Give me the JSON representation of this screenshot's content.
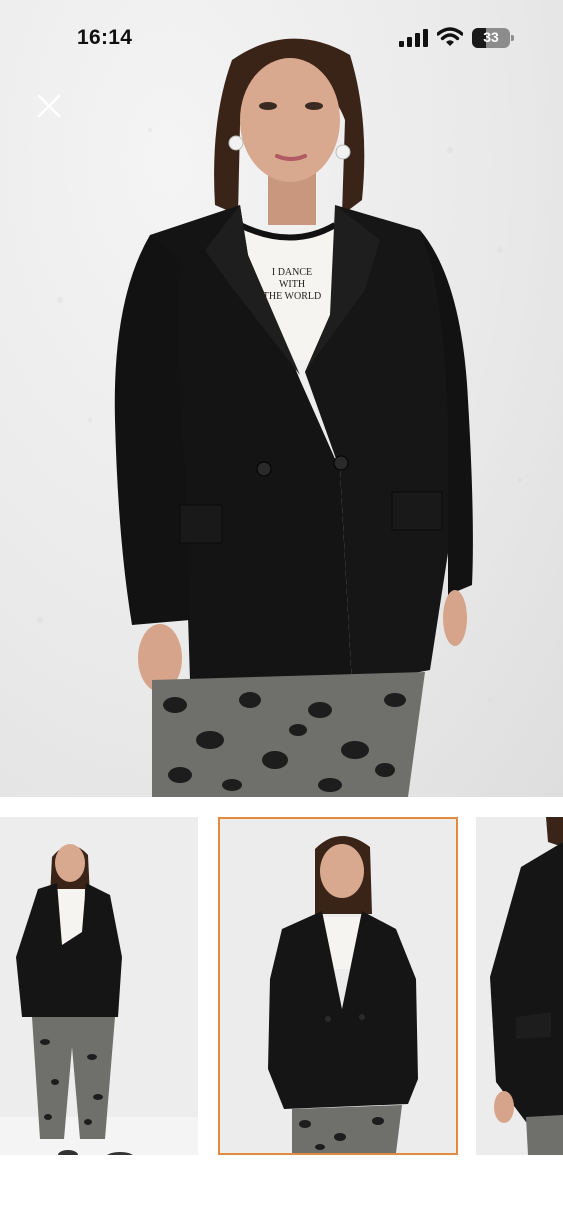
{
  "status_bar": {
    "time": "16:14",
    "battery_level": "33",
    "icons": [
      "cellular-signal-icon",
      "wifi-icon",
      "battery-icon"
    ]
  },
  "hero": {
    "image": "model-in-black-double-breasted-blazer",
    "shirt_text_line1": "I DANCE",
    "shirt_text_line2": "WITH",
    "shirt_text_line3": "THE WORLD"
  },
  "close_icon": "close-icon",
  "gallery": {
    "thumbnails": [
      {
        "image": "full-body-front-view",
        "selected": false
      },
      {
        "image": "three-quarter-front-view",
        "selected": true
      },
      {
        "image": "side-view-cropped",
        "selected": false
      }
    ],
    "selected_border_color": "#e28a3f"
  },
  "colors": {
    "blazer": "#141414",
    "background_wall": "#e8e8e8",
    "accent": "#e28a3f"
  }
}
